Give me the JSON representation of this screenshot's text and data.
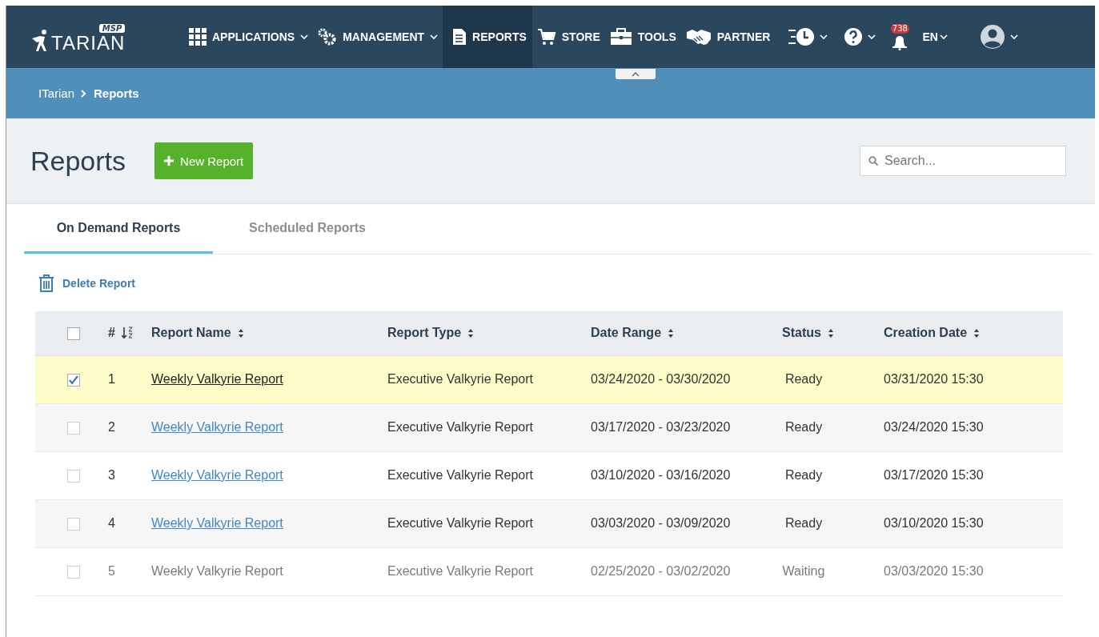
{
  "navbar": {
    "logo": {
      "badge": "MSP",
      "text": "TARIAN"
    },
    "items": [
      {
        "label": "APPLICATIONS",
        "dropdown": true,
        "selected": false
      },
      {
        "label": "MANAGEMENT",
        "dropdown": true,
        "selected": false
      },
      {
        "label": "REPORTS",
        "dropdown": false,
        "selected": true
      },
      {
        "label": "STORE",
        "dropdown": false,
        "selected": false
      },
      {
        "label": "TOOLS",
        "dropdown": false,
        "selected": false
      },
      {
        "label": "PARTNER",
        "dropdown": false,
        "selected": false
      }
    ],
    "notifications": "738",
    "language": "EN"
  },
  "breadcrumb": [
    {
      "label": "ITarian",
      "current": false
    },
    {
      "label": "Reports",
      "current": true
    }
  ],
  "page": {
    "title": "Reports",
    "new_button": "New Report",
    "search": {
      "placeholder": "Search..."
    }
  },
  "tabs": [
    {
      "label": "On Demand Reports",
      "selected": true
    },
    {
      "label": "Scheduled Reports",
      "selected": false
    }
  ],
  "toolbar": {
    "delete_button": "Delete Report"
  },
  "table": {
    "select_all_checked": false,
    "columns": [
      "#",
      "Report Name",
      "Report Type",
      "Date Range",
      "Status",
      "Creation Date"
    ],
    "rows": [
      {
        "selected": true,
        "checked": true,
        "disabled": false,
        "cells": [
          "1",
          "Weekly Valkyrie Report",
          "Executive Valkyrie Report",
          "03/24/2020 - 03/30/2020",
          "Ready",
          "03/31/2020 15:30"
        ]
      },
      {
        "selected": false,
        "checked": false,
        "disabled": false,
        "cells": [
          "2",
          "Weekly Valkyrie Report",
          "Executive Valkyrie Report",
          "03/17/2020 - 03/23/2020",
          "Ready",
          "03/24/2020 15:30"
        ]
      },
      {
        "selected": false,
        "checked": false,
        "disabled": false,
        "cells": [
          "3",
          "Weekly Valkyrie Report",
          "Executive Valkyrie Report",
          "03/10/2020 - 03/16/2020",
          "Ready",
          "03/17/2020 15:30"
        ]
      },
      {
        "selected": false,
        "checked": false,
        "disabled": false,
        "cells": [
          "4",
          "Weekly Valkyrie Report",
          "Executive Valkyrie Report",
          "03/03/2020 - 03/09/2020",
          "Ready",
          "03/10/2020 15:30"
        ]
      },
      {
        "selected": false,
        "checked": false,
        "disabled": true,
        "cells": [
          "5",
          "Weekly Valkyrie Report",
          "Executive Valkyrie Report",
          "02/25/2020 - 03/02/2020",
          "Waiting",
          "03/03/2020 15:30"
        ]
      }
    ]
  }
}
